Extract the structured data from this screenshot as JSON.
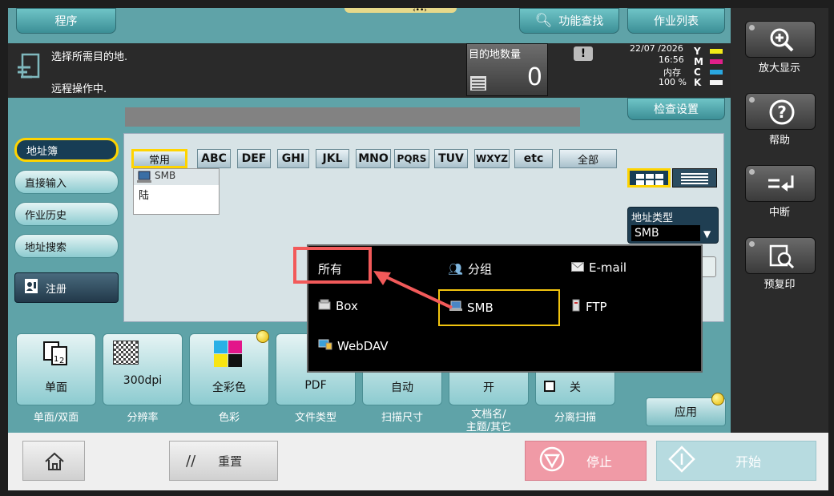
{
  "top": {
    "program_label": "程序",
    "func_search_label": "功能查找",
    "job_list_label": "作业列表"
  },
  "info": {
    "message1": "选择所需目的地.",
    "message2": "远程操作中.",
    "dest_count_label": "目的地数量",
    "dest_count_value": "0",
    "date": "22/07 /2026",
    "time": "16:56",
    "memory_label": "内存",
    "memory_value": "100 %",
    "toner": [
      "Y",
      "M",
      "C",
      "K"
    ],
    "check_settings_label": "检查设置"
  },
  "tabs": {
    "address_book": "地址簿",
    "direct_input": "直接输入",
    "job_history": "作业历史",
    "address_search": "地址搜索",
    "register": "注册"
  },
  "index": {
    "common": "常用",
    "letters": [
      "ABC",
      "DEF",
      "GHI",
      "JKL",
      "MNO",
      "PQRS",
      "TUV",
      "WXYZ",
      "etc"
    ],
    "all": "全部"
  },
  "entry": {
    "type": "SMB",
    "name": "陆"
  },
  "address_type": {
    "label": "地址类型",
    "value": "SMB"
  },
  "popup": {
    "all": "所有",
    "group": "分组",
    "email": "E-mail",
    "box": "Box",
    "smb": "SMB",
    "ftp": "FTP",
    "webdav": "WebDAV"
  },
  "settings": {
    "simplex_value": "单面",
    "simplex_label": "单面/双面",
    "resolution_value": "300dpi",
    "resolution_label": "分辨率",
    "color_value": "全彩色",
    "color_label": "色彩",
    "filetype_value": "PDF",
    "filetype_label": "文件类型",
    "scansize_value": "自动",
    "scansize_label": "扫描尺寸",
    "docname_value": "开",
    "docname_label": "文档名/\n主题/其它",
    "separate_value": "关",
    "separate_label": "分离扫描"
  },
  "apply_label": "应用",
  "right": {
    "zoom": "放大显示",
    "help": "帮助",
    "interrupt": "中断",
    "preview": "预复印"
  },
  "bottom": {
    "reset": "重置",
    "stop": "停止",
    "start": "开始"
  }
}
